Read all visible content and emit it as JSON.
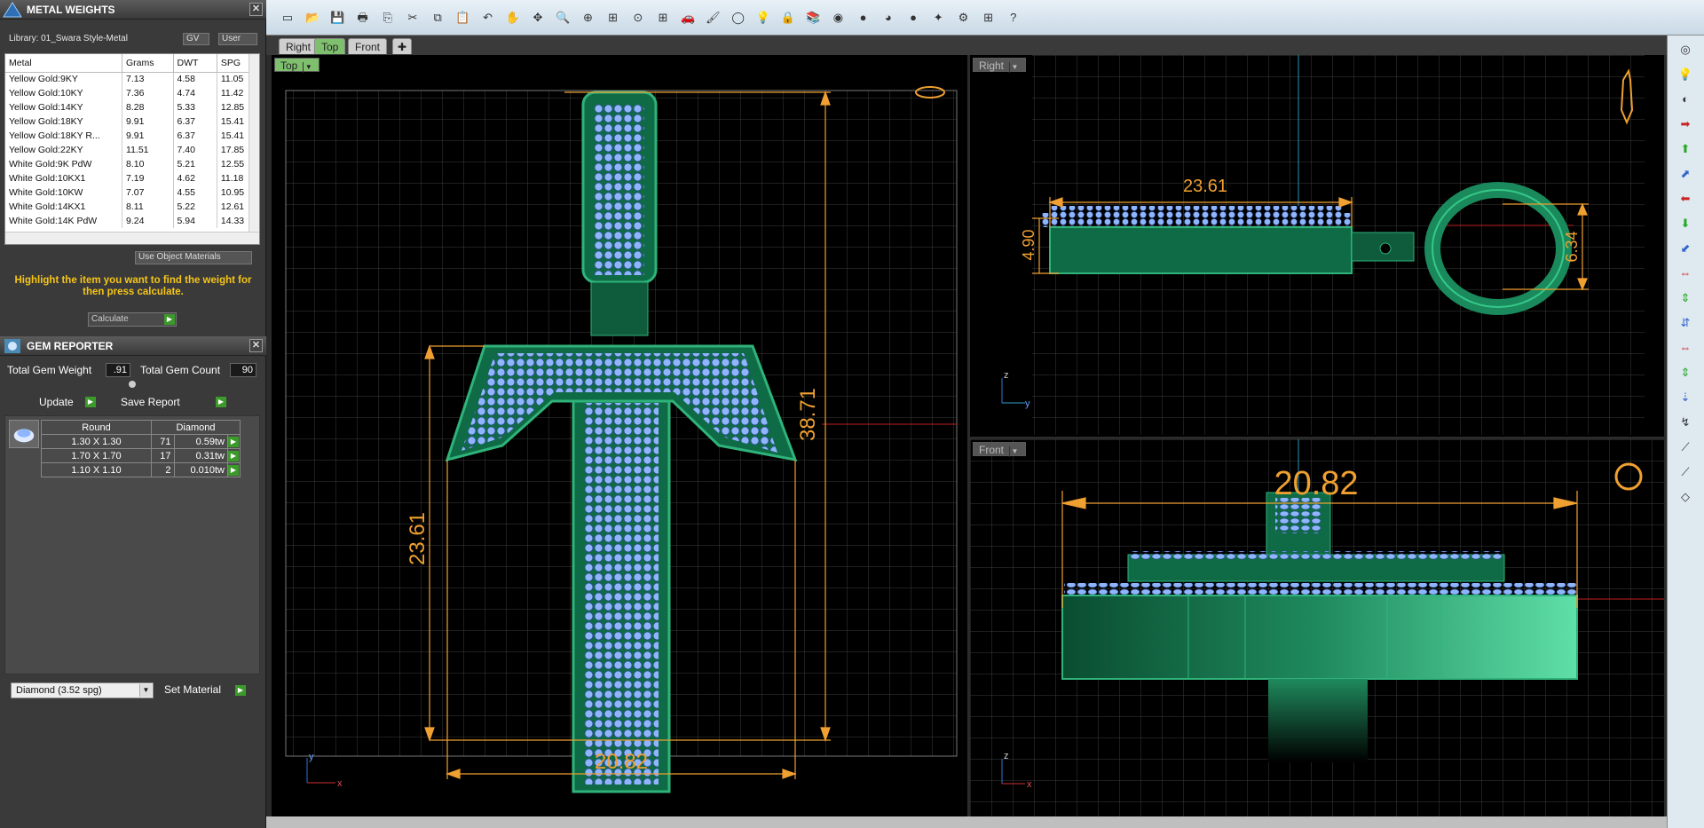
{
  "metal_weights": {
    "title": "METAL WEIGHTS",
    "library_label": "Library: 01_Swara Style-Metal",
    "gv_label": "GV",
    "user_label": "User",
    "columns": [
      "Metal",
      "Grams",
      "DWT",
      "SPG"
    ],
    "rows": [
      [
        "Yellow Gold:9KY",
        "7.13",
        "4.58",
        "11.05"
      ],
      [
        "Yellow Gold:10KY",
        "7.36",
        "4.74",
        "11.42"
      ],
      [
        "Yellow Gold:14KY",
        "8.28",
        "5.33",
        "12.85"
      ],
      [
        "Yellow Gold:18KY",
        "9.91",
        "6.37",
        "15.41"
      ],
      [
        "Yellow Gold:18KY R...",
        "9.91",
        "6.37",
        "15.41"
      ],
      [
        "Yellow Gold:22KY",
        "11.51",
        "7.40",
        "17.85"
      ],
      [
        "White Gold:9K PdW",
        "8.10",
        "5.21",
        "12.55"
      ],
      [
        "White Gold:10KX1",
        "7.19",
        "4.62",
        "11.18"
      ],
      [
        "White Gold:10KW",
        "7.07",
        "4.55",
        "10.95"
      ],
      [
        "White Gold:14KX1",
        "8.11",
        "5.22",
        "12.61"
      ],
      [
        "White Gold:14K PdW",
        "9.24",
        "5.94",
        "14.33"
      ]
    ],
    "use_object_materials": "Use Object Materials",
    "hint": "Highlight the item you want to find the weight for then press calculate.",
    "calculate_label": "Calculate"
  },
  "gem_reporter": {
    "title": "GEM REPORTER",
    "total_weight_label": "Total Gem Weight",
    "total_weight_value": ".91",
    "total_count_label": "Total Gem Count",
    "total_count_value": "90",
    "update_label": "Update",
    "save_report_label": "Save Report",
    "columns": [
      "Round",
      "Diamond"
    ],
    "rows": [
      [
        "1.30 X 1.30",
        "71",
        "0.59tw"
      ],
      [
        "1.70 X 1.70",
        "17",
        "0.31tw"
      ],
      [
        "1.10 X 1.10",
        "2",
        "0.010tw"
      ]
    ],
    "material_value": "Diamond    (3.52 spg)",
    "set_material_label": "Set Material"
  },
  "tabs": [
    "Right",
    "Top",
    "Front"
  ],
  "viewports": {
    "top": {
      "label": "Top",
      "dim_width": "20.82",
      "dim_height": "38.71",
      "dim_body": "23.61",
      "axis_y": "y",
      "axis_x": "x"
    },
    "right": {
      "label": "Right",
      "dim_width": "23.61",
      "dim_height": "4.90",
      "dim_loop": "6.34",
      "axis_z": "z",
      "axis_y": "y"
    },
    "front": {
      "label": "Front",
      "dim_width": "20.82",
      "axis_z": "z",
      "axis_x": "x"
    }
  },
  "toolbar_icons": [
    "new-file-icon",
    "open-folder-icon",
    "save-icon",
    "print-icon",
    "copy-icon",
    "cut-icon",
    "paste-icon",
    "clipboard-icon",
    "undo-icon",
    "pan-hand-icon",
    "move-icon",
    "zoom-icon",
    "zoom-window-icon",
    "zoom-extents-icon",
    "zoom-selected-icon",
    "viewport-layout-icon",
    "car-icon",
    "paint-icon",
    "circle-icon",
    "lightbulb-icon",
    "lock-icon",
    "layers-icon",
    "color-wheel-icon",
    "sphere-icon",
    "shaded-sphere-icon",
    "blue-sphere-icon",
    "wand-icon",
    "gear-icon",
    "grid-icon",
    "help-icon"
  ],
  "colors": {
    "accent_green": "#7fc06f",
    "dimension": "#f0a030",
    "jewel": "#1f8a5e",
    "gem": "#9ec7ff"
  }
}
